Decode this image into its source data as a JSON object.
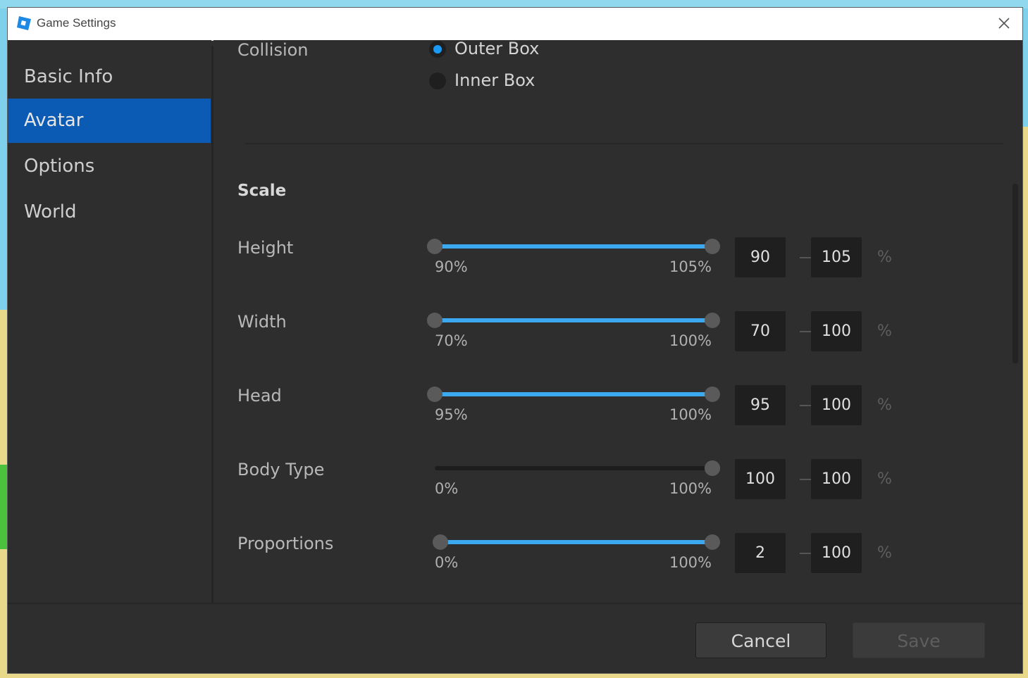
{
  "window": {
    "title": "Game Settings"
  },
  "sidebar": {
    "items": [
      {
        "label": "Basic Info",
        "active": false
      },
      {
        "label": "Avatar",
        "active": true
      },
      {
        "label": "Options",
        "active": false
      },
      {
        "label": "World",
        "active": false
      }
    ]
  },
  "collision": {
    "label": "Collision",
    "options": [
      {
        "label": "Outer Box",
        "checked": true
      },
      {
        "label": "Inner Box",
        "checked": false
      }
    ]
  },
  "scale": {
    "heading": "Scale",
    "rows": [
      {
        "label": "Height",
        "min_label": "90%",
        "max_label": "105%",
        "low_value": "90",
        "high_value": "105",
        "unit": "%",
        "low_fraction": 0,
        "high_fraction": 1
      },
      {
        "label": "Width",
        "min_label": "70%",
        "max_label": "100%",
        "low_value": "70",
        "high_value": "100",
        "unit": "%",
        "low_fraction": 0,
        "high_fraction": 1
      },
      {
        "label": "Head",
        "min_label": "95%",
        "max_label": "100%",
        "low_value": "95",
        "high_value": "100",
        "unit": "%",
        "low_fraction": 0,
        "high_fraction": 1
      },
      {
        "label": "Body Type",
        "min_label": "0%",
        "max_label": "100%",
        "low_value": "100",
        "high_value": "100",
        "unit": "%",
        "low_fraction": 1,
        "high_fraction": 1
      },
      {
        "label": "Proportions",
        "min_label": "0%",
        "max_label": "100%",
        "low_value": "2",
        "high_value": "100",
        "unit": "%",
        "low_fraction": 0.02,
        "high_fraction": 1
      }
    ]
  },
  "footer": {
    "cancel_label": "Cancel",
    "save_label": "Save"
  },
  "colors": {
    "accent": "#0b5bb5",
    "slider_fill": "#3ba8ef",
    "radio_checked": "#1a9af5"
  }
}
